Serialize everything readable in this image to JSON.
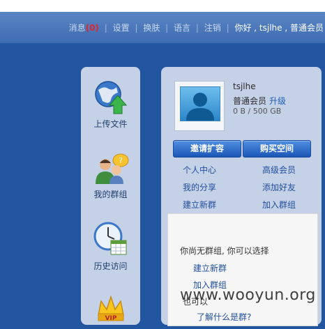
{
  "topnav": {
    "messages_label": "消息",
    "messages_count": "(0)",
    "settings": "设置",
    "skin": "换肤",
    "language": "语言",
    "logout": "注销",
    "greeting": "你好 , tsjlhe , 普通会员"
  },
  "sidebar": {
    "items": [
      {
        "label": "上传文件",
        "icon": "upload-globe-icon"
      },
      {
        "label": "我的群组",
        "icon": "group-people-icon"
      },
      {
        "label": "历史访问",
        "icon": "history-clock-icon"
      },
      {
        "label": "VIP",
        "icon": "vip-crown-icon"
      }
    ]
  },
  "profile": {
    "username": "tsjlhe",
    "level": "普通会员",
    "upgrade": "升级",
    "quota": "0 B / 500 GB"
  },
  "buttons": {
    "invite": "邀请扩容",
    "buy": "购买空间"
  },
  "quick_links": {
    "personal_center": "个人中心",
    "premium_member": "高级会员",
    "my_share": "我的分享",
    "add_friend": "添加好友",
    "create_group": "建立新群",
    "join_group": "加入群组"
  },
  "groups": {
    "prompt": "你尚无群组, 你可以选择",
    "create": "建立新群",
    "join": "加入群组",
    "partial": "也可以",
    "what_is": "了解什么是群?"
  },
  "watermark": "www.wooyun.org",
  "colors": {
    "background": "#2155a0",
    "panel": "#c5d1e7",
    "button": "#2a66c4",
    "link": "#1f4f9c",
    "alert": "#e5242b"
  }
}
